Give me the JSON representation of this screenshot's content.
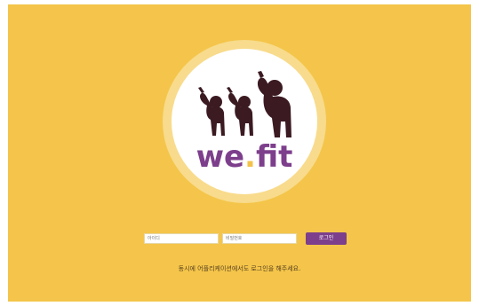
{
  "brand": {
    "name_part1": "we",
    "name_dot": ".",
    "name_part2": "fit"
  },
  "login": {
    "id_placeholder": "아이디",
    "password_placeholder": "비밀번호",
    "button_label": "로그인"
  },
  "notice": "동시에 어플리케이션에서도 로그인을 해주세요.",
  "colors": {
    "background": "#f4c54a",
    "brand_purple": "#7d3f8c",
    "figure_dark": "#3b1a22",
    "ring": "#f8db8c"
  },
  "icons": [
    "stretching-person-icon",
    "stretching-person-icon",
    "stretching-person-icon"
  ]
}
